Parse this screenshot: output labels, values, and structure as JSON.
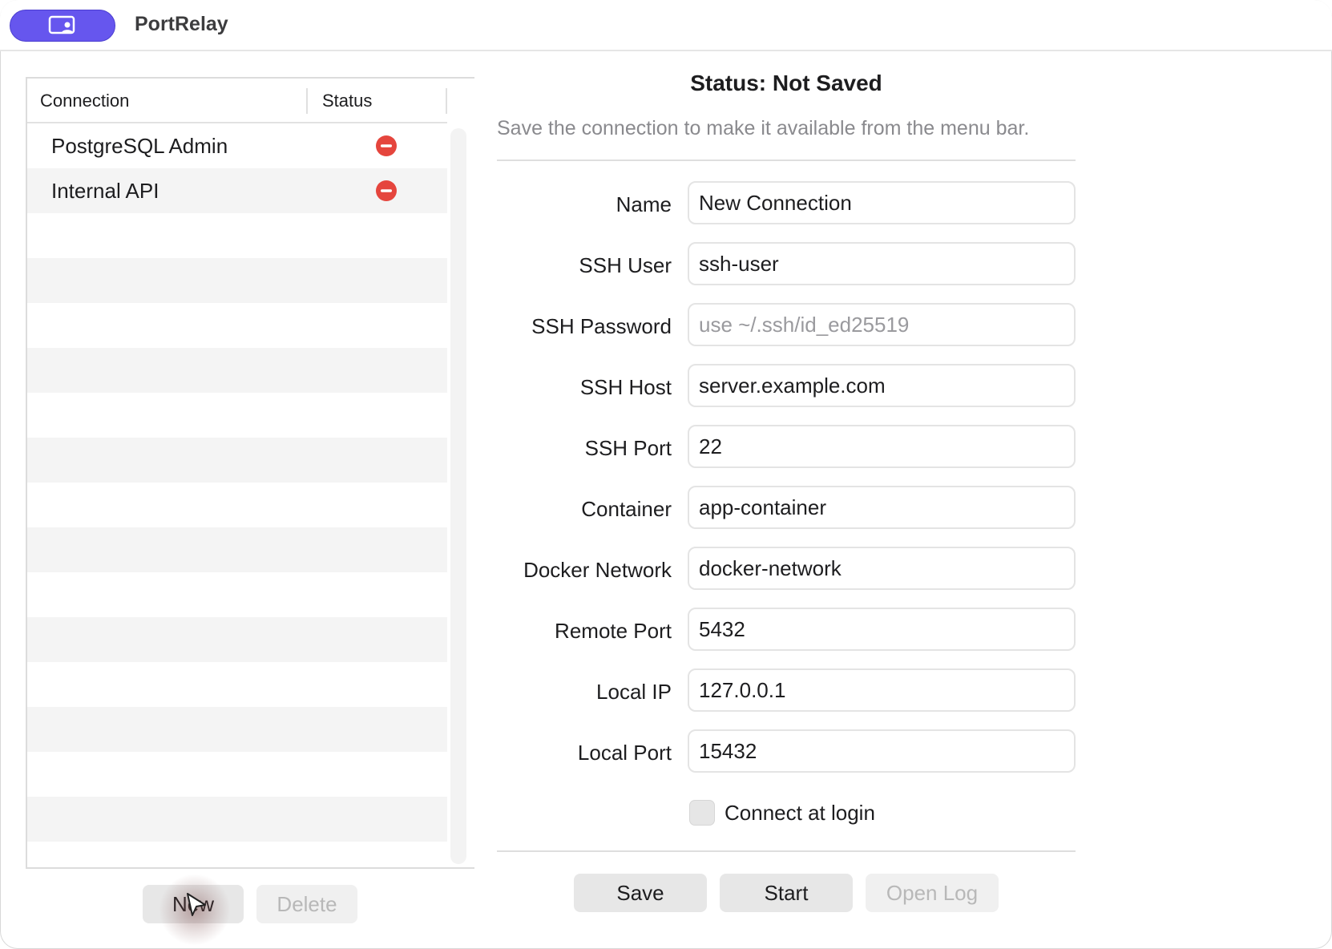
{
  "app": {
    "title": "PortRelay",
    "accent_color": "#6656ee",
    "icon": "person-screen-icon"
  },
  "connections": {
    "headers": {
      "connection": "Connection",
      "status": "Status"
    },
    "items": [
      {
        "name": "PostgreSQL Admin",
        "status_icon": "stopped-icon"
      },
      {
        "name": "Internal API",
        "status_icon": "stopped-icon"
      }
    ],
    "status_color": "#e5453d",
    "new_label": "New",
    "delete_label": "Delete"
  },
  "detail": {
    "status_title": "Status: Not Saved",
    "status_subtitle": "Save the connection to make it available from the menu bar.",
    "fields": {
      "name": {
        "label": "Name",
        "value": "New Connection"
      },
      "ssh_user": {
        "label": "SSH User",
        "value": "ssh-user"
      },
      "ssh_password": {
        "label": "SSH Password",
        "value": "",
        "placeholder": "use ~/.ssh/id_ed25519"
      },
      "ssh_host": {
        "label": "SSH Host",
        "value": "server.example.com"
      },
      "ssh_port": {
        "label": "SSH Port",
        "value": "22"
      },
      "container": {
        "label": "Container",
        "value": "app-container"
      },
      "docker_network": {
        "label": "Docker Network",
        "value": "docker-network"
      },
      "remote_port": {
        "label": "Remote Port",
        "value": "5432"
      },
      "local_ip": {
        "label": "Local IP",
        "value": "127.0.0.1"
      },
      "local_port": {
        "label": "Local Port",
        "value": "15432"
      }
    },
    "connect_at_login": {
      "label": "Connect at login",
      "checked": false
    },
    "buttons": {
      "save": "Save",
      "start": "Start",
      "open_log": "Open Log"
    }
  }
}
